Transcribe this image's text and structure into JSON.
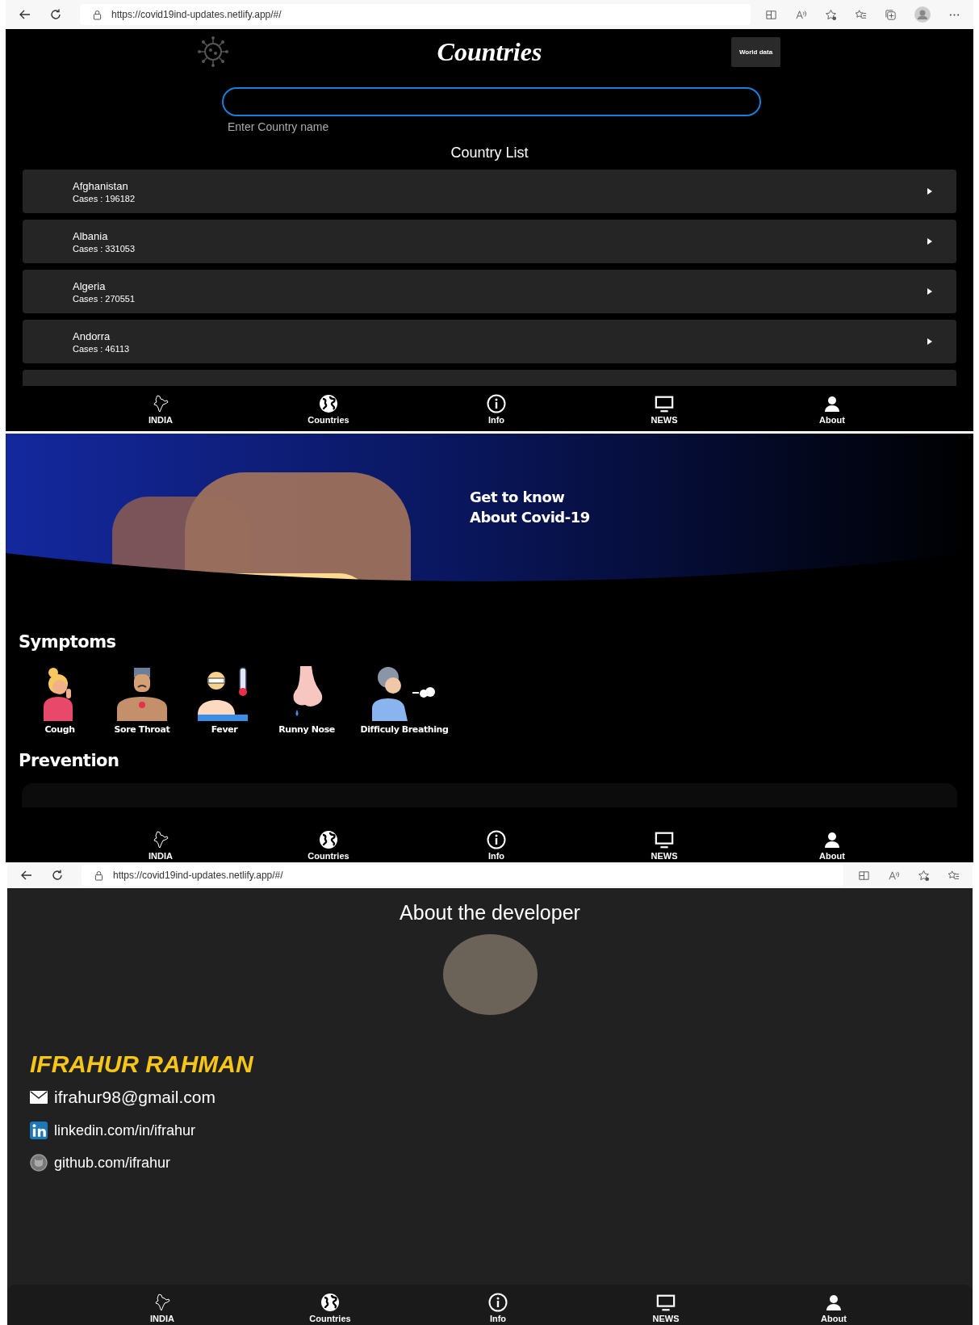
{
  "countries_screen": {
    "browser": {
      "url": "https://covid19ind-updates.netlify.app/#/"
    },
    "title": "Countries",
    "world_data_button": "World data",
    "search": {
      "label": "Enter Country name"
    },
    "list_title": "Country List",
    "countries": [
      {
        "name": "Afghanistan",
        "cases": "Cases : 196182"
      },
      {
        "name": "Albania",
        "cases": "Cases : 331053"
      },
      {
        "name": "Algeria",
        "cases": "Cases : 270551"
      },
      {
        "name": "Andorra",
        "cases": "Cases : 46113"
      }
    ],
    "nav": [
      {
        "label": "INDIA",
        "kind": "india"
      },
      {
        "label": "Countries",
        "kind": "globe"
      },
      {
        "label": "Info",
        "kind": "info"
      },
      {
        "label": "NEWS",
        "kind": "tv"
      },
      {
        "label": "About",
        "kind": "person"
      }
    ]
  },
  "info_screen": {
    "hero_lines": [
      "Get to know",
      "About Covid-19"
    ],
    "symptoms_title": "Symptoms",
    "symptoms": [
      {
        "label": "Cough",
        "kind": "cough"
      },
      {
        "label": "Sore Throat",
        "kind": "throat"
      },
      {
        "label": "Fever",
        "kind": "fever"
      },
      {
        "label": "Runny Nose",
        "kind": "nose"
      },
      {
        "label": "Difficuly Breathing",
        "kind": "breath"
      }
    ],
    "prevention_title": "Prevention",
    "nav": [
      {
        "label": "INDIA",
        "kind": "india"
      },
      {
        "label": "Countries",
        "kind": "globe"
      },
      {
        "label": "Info",
        "kind": "info"
      },
      {
        "label": "NEWS",
        "kind": "tv"
      },
      {
        "label": "About",
        "kind": "person"
      }
    ]
  },
  "about_screen": {
    "browser": {
      "url": "https://covid19ind-updates.netlify.app/#/"
    },
    "title": "About the developer",
    "name": "IFRAHUR RAHMAN",
    "contacts": [
      {
        "text": "ifrahur98@gmail.com",
        "kind": "email"
      },
      {
        "text": "linkedin.com/in/ifrahur",
        "kind": "linkedin"
      },
      {
        "text": "github.com/ifrahur",
        "kind": "github"
      }
    ],
    "nav": [
      {
        "label": "INDIA",
        "kind": "india"
      },
      {
        "label": "Countries",
        "kind": "globe"
      },
      {
        "label": "Info",
        "kind": "info"
      },
      {
        "label": "NEWS",
        "kind": "tv"
      },
      {
        "label": "About",
        "kind": "person"
      }
    ]
  }
}
